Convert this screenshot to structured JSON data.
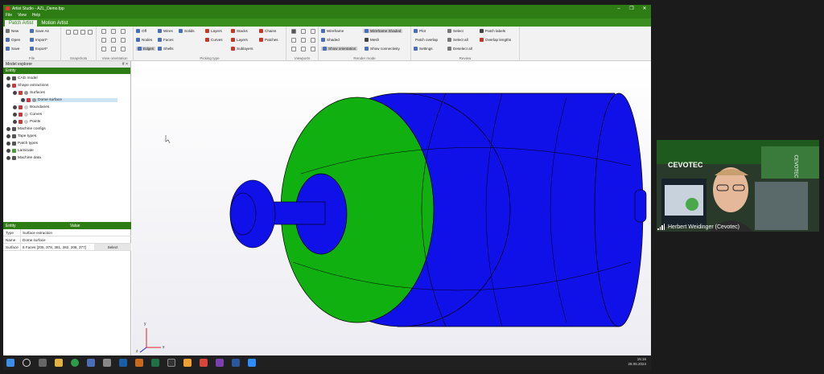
{
  "app": {
    "title": "Artist Studio - AZL_Demo.fpp",
    "menu": [
      "File",
      "View",
      "Help"
    ],
    "tabs": [
      "Patch Artist",
      "Motion Artist"
    ]
  },
  "ribbon": {
    "file": {
      "label": "File",
      "items": [
        "New",
        "Save As",
        "Open",
        "Import*",
        "Save",
        "Export*"
      ]
    },
    "snapshots": {
      "label": "Snapshots"
    },
    "view_orientation": {
      "label": "View orientation"
    },
    "picking": {
      "label": "Picking type",
      "items": [
        "Off",
        "Wires",
        "Solids",
        "Nodes",
        "Faces",
        "Edges",
        "Shells",
        "Layers",
        "Stacks",
        "Chains",
        "Curves",
        "Layers",
        "Patches",
        "Sublayers"
      ]
    },
    "viewports": {
      "label": "Viewports"
    },
    "render": {
      "label": "Render mode",
      "items": [
        "Wireframe",
        "Wireframe Shaded",
        "Shaded",
        "Mesh",
        "Show orientation",
        "Show connectivity"
      ]
    },
    "review": {
      "label": "Review",
      "items": [
        "Plot",
        "Select",
        "Patch labels",
        "Patch overlap",
        "Select all",
        "Overlap lengths",
        "Settings",
        "Deselect all"
      ]
    }
  },
  "explorer": {
    "title": "Model explorer",
    "pin": "# ×",
    "header": "Entity",
    "tree": [
      "CAD model",
      "Shape extractions",
      "Surfaces",
      "Dome surface",
      "Boundaries",
      "Curves",
      "Points",
      "Machine configs",
      "Tape types",
      "Patch types",
      "Laminate",
      "Machine data"
    ]
  },
  "properties": {
    "col_entity": "Entity",
    "col_value": "Value",
    "rows": [
      {
        "k": "Type",
        "v": "Surface extraction"
      },
      {
        "k": "Name",
        "v": "Dome surface"
      },
      {
        "k": "Surface",
        "v": "6 Faces [205, 378, 381, 382, 208, 377]",
        "button": "Select"
      }
    ]
  },
  "axes": {
    "x": "x",
    "y": "y",
    "z": "z"
  },
  "clock": {
    "time": "15:16",
    "date": "28.05.2024"
  },
  "participant": {
    "name": "Herbert Weidinger (Cevotec)",
    "logo": "CEVOTEC",
    "wall_text": "CEVOTEC"
  },
  "colors": {
    "accent": "#2e7d14",
    "tank_blue": "#1010e8",
    "dome_green": "#10b010"
  }
}
